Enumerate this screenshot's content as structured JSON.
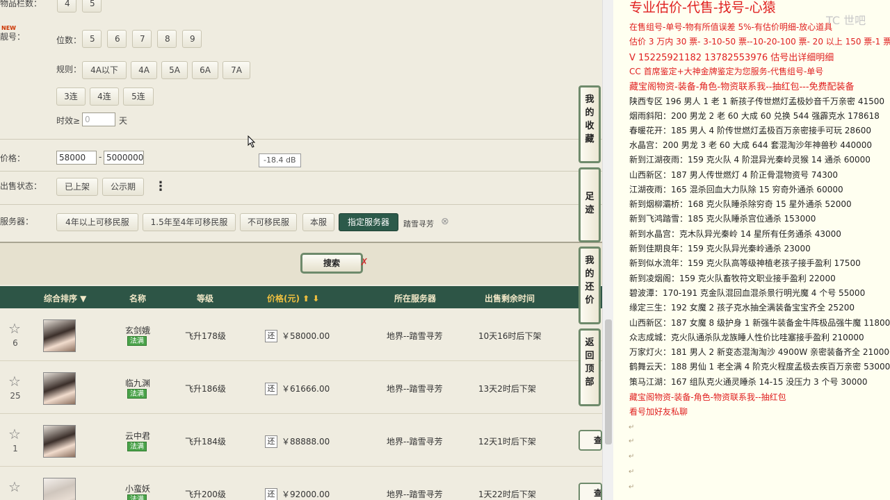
{
  "filters": {
    "top_label": "物品栏数：",
    "top_values": [
      "4",
      "5"
    ],
    "new_tag": "NEW",
    "lianghao_label": "靓号：",
    "weishu_label": "位数：",
    "weishu_options": [
      "5",
      "6",
      "7",
      "8",
      "9"
    ],
    "guize_label": "规则：",
    "guize_options": [
      "4A以下",
      "4A",
      "5A",
      "6A",
      "7A"
    ],
    "lian_options": [
      "3连",
      "4连",
      "5连"
    ],
    "shixiao_label": "时效≥",
    "shixiao_value": "0",
    "shixiao_unit": "天",
    "price_label": "价格：",
    "price_min": "58000",
    "price_sep": "-",
    "price_max": "5000000",
    "sale_label": "出售状态：",
    "sale_options": [
      "已上架",
      "公示期"
    ],
    "more_glyph": "⋮",
    "server_label": "服务器：",
    "server_options": [
      "4年以上可移民服",
      "1.5年至4年可移民服",
      "不可移民服",
      "本服",
      "指定服务器"
    ],
    "server_selected": "踏雪寻芳",
    "clear_glyph": "⊗"
  },
  "tooltip": "-18.4 dB",
  "search_label": "搜索",
  "search_mark": "✗",
  "table": {
    "headers": {
      "sort": "综合排序 ▼",
      "name": "名称",
      "level": "等级",
      "price": "价格(元) ⬆ ⬇",
      "server": "所在服务器",
      "remain": "出售剩余时间"
    },
    "rows": [
      {
        "count": "6",
        "name": "玄剑娥",
        "badge": "法满",
        "level": "飞升178级",
        "hui": "还",
        "price": "￥58000.00",
        "server": "地界--踏雪寻芳",
        "remain": "10天16时后下架",
        "view": ""
      },
      {
        "count": "25",
        "name": "临九渊",
        "badge": "法满",
        "level": "飞升186级",
        "hui": "还",
        "price": "￥61666.00",
        "server": "地界--踏雪寻芳",
        "remain": "13天2时后下架",
        "view": ""
      },
      {
        "count": "1",
        "name": "云中君",
        "badge": "法满",
        "level": "飞升184级",
        "hui": "还",
        "price": "￥88888.00",
        "server": "地界--踏雪寻芳",
        "remain": "12天1时后下架",
        "view": "查"
      },
      {
        "count": "",
        "name": "小蛮妖",
        "badge": "法满",
        "level": "飞升200级",
        "hui": "还",
        "price": "￥92000.00",
        "server": "地界--踏雪寻芳",
        "remain": "1天22时后下架",
        "view": "查"
      }
    ]
  },
  "side_buttons": {
    "collect": "我的收藏",
    "trace": "足迹",
    "bargain": "我的还价",
    "top": "返回顶部"
  },
  "right": {
    "title": "专业估价-代售-找号-心猿",
    "watermark": "TC 世吧",
    "l1": "在售组号-单号-物有所值误差 5%-有估价明细-放心道具",
    "l2": "估价 3 万内 30 票- 3-10-50 票--10-20-100 票- 20 以上 150 票-1 票 1 元",
    "l3": "V 15225921182    13782553976    估号出详细明细",
    "l4": "CC 首席鉴定+大神金牌鉴定为您服务-代售组号-单号",
    "l5": "藏宝阁物资-装备-角色-物资联系我--抽红包---免费配装备",
    "list": [
      "陕西专区 196 男人 1 老 1 新孩子传世燃灯孟极妙音千万亲密 41500",
      "烟雨斜阳：200 男龙 2 老 60 大成 60 兑换 544 强霹克水 178618",
      "春暖花开：185 男人 4 阶传世燃灯孟极百万亲密接手可玩 28600",
      "水晶宫：200 男龙 3 老 60 大成 644 套混淘沙年神兽秒 440000",
      "新到江湖夜雨：159 克火队 4 阶混异光秦岭灵猴 14 通杀 60000",
      "山西新区：187 男人传世燃灯 4 阶正骨混物资号 74300",
      "江湖夜雨：165 混杀回血大力队除 15 穷奇外通杀 60000",
      "新到烟柳灞桥：168 克火队睡杀除穷奇 15 星外通杀 52000",
      "新到飞鸿踏雪：185 克火队睡杀宫位通杀 153000",
      "新到水晶宫：克木队异光秦岭 14 星所有任务通杀 43000",
      "新到佳期良年：159 克火队异光秦岭通杀 23000",
      "新到似水流年：159 克火队高等级神植老孩子接手盈利 17500",
      "新到凌烟阁：159 克火队畜牧符文职业接手盈利 22000",
      "碧波潭：170-191 克金队混回血混杀景行明光魔 4 个号 55000",
      "缘定三生：192 女魔 2 孩子克水抽全满装备宝宝齐全 25200",
      "山西新区：187 女魔 8 级护身 1 新强牛装备金牛阵极品强牛魔 11800",
      "众志成城：克火队通杀队龙族睡人性价比哇塞接手盈利 210000",
      "万家灯火：181 男人 2 新变态混淘淘沙 4900W 亲密装备齐全 210000",
      "鹤舞云天：188 男仙 1 老全满 4 阶克火程度孟极去疾百万亲密 53000",
      "策马江湖：167 组队克火通灵睡杀 14-15 没压力 3 个号 30000"
    ],
    "footer1": "藏宝阁物资-装备-角色-物资联系我--抽红包",
    "footer2": "看号加好友私聊"
  },
  "colors": {
    "header_bg": "#2d5546",
    "active_btn": "#2c5a4a",
    "badge_green": "#4aa34a",
    "red_text": "#e02020",
    "right_bg": "#fffff0"
  }
}
